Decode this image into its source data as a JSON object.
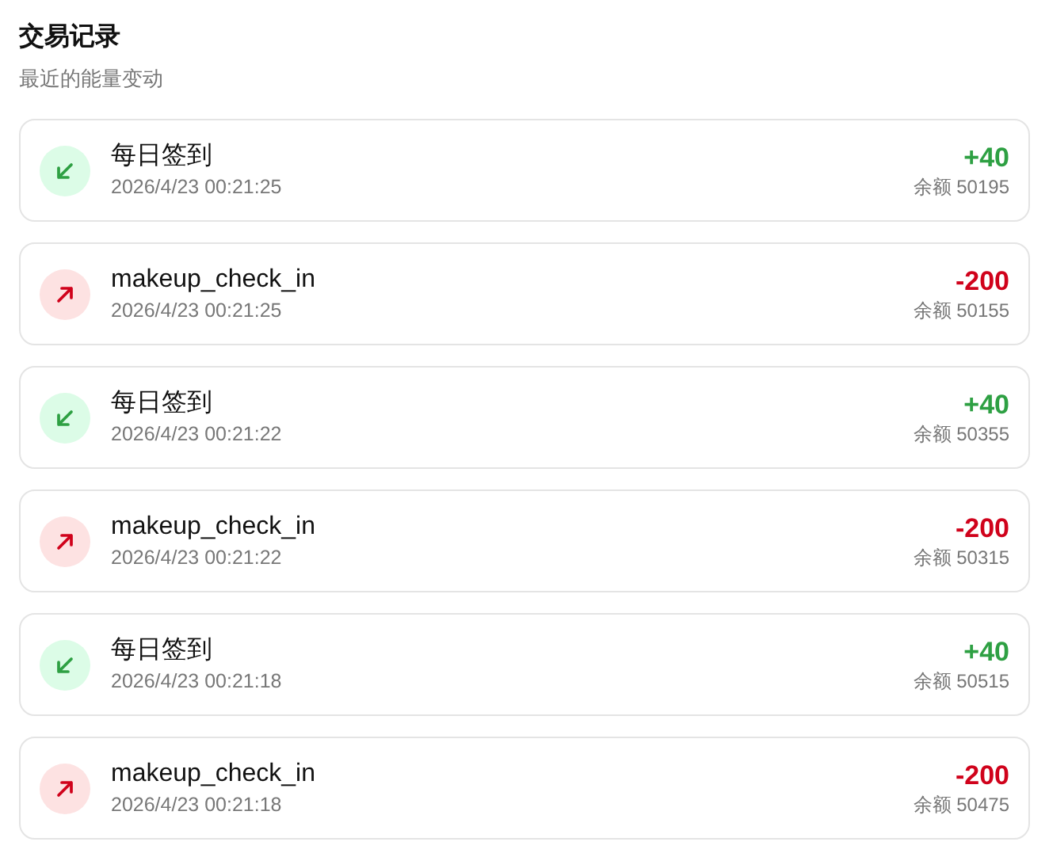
{
  "header": {
    "title": "交易记录",
    "subtitle": "最近的能量变动"
  },
  "transactions": [
    {
      "kind": "income",
      "name": "每日签到",
      "time": "2026/4/23 00:21:25",
      "amount": "+40",
      "balance": "余额 50195"
    },
    {
      "kind": "expense",
      "name": "makeup_check_in",
      "time": "2026/4/23 00:21:25",
      "amount": "-200",
      "balance": "余额 50155"
    },
    {
      "kind": "income",
      "name": "每日签到",
      "time": "2026/4/23 00:21:22",
      "amount": "+40",
      "balance": "余额 50355"
    },
    {
      "kind": "expense",
      "name": "makeup_check_in",
      "time": "2026/4/23 00:21:22",
      "amount": "-200",
      "balance": "余额 50315"
    },
    {
      "kind": "income",
      "name": "每日签到",
      "time": "2026/4/23 00:21:18",
      "amount": "+40",
      "balance": "余额 50515"
    },
    {
      "kind": "expense",
      "name": "makeup_check_in",
      "time": "2026/4/23 00:21:18",
      "amount": "-200",
      "balance": "余额 50475"
    }
  ]
}
